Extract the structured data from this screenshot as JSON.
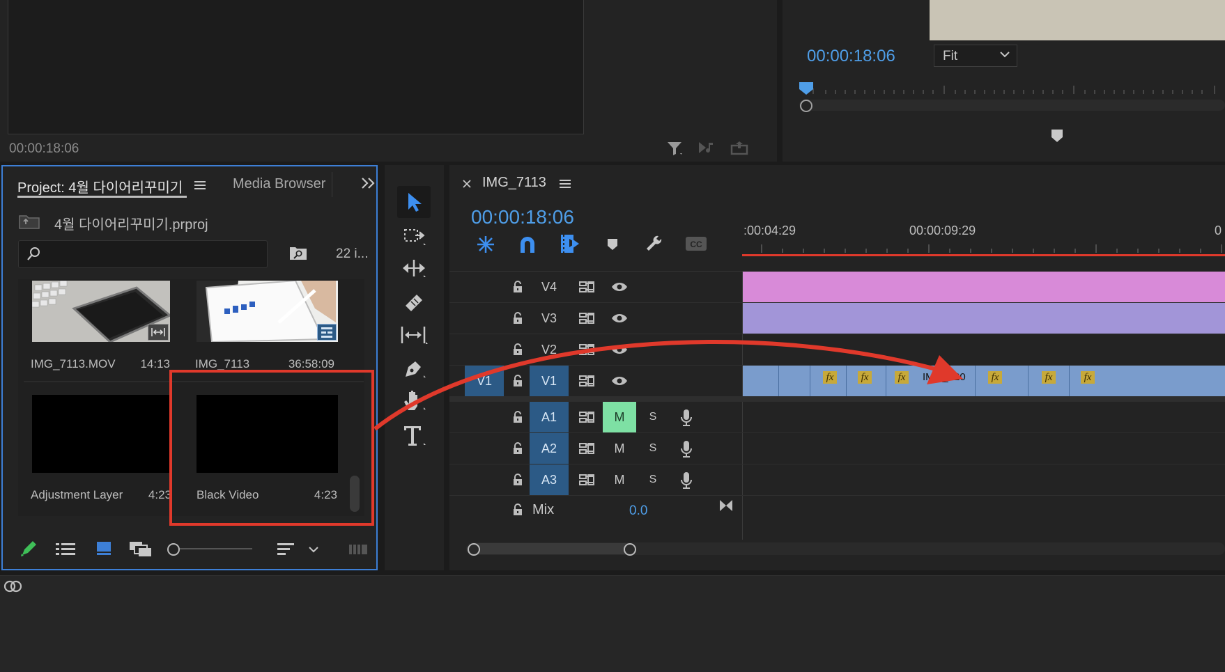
{
  "source_monitor": {
    "timecode": "00:00:18:06"
  },
  "program_monitor": {
    "timecode": "00:00:18:06",
    "zoom": "Fit"
  },
  "project_panel": {
    "tab_project": "Project: 4월 다이어리꾸미기",
    "tab_media_browser": "Media Browser",
    "project_file": "4월 다이어리꾸미기.prproj",
    "search_placeholder": "",
    "item_count": "22 i...",
    "items": [
      {
        "name": "IMG_7113.MOV",
        "duration": "14:13"
      },
      {
        "name": "IMG_7113",
        "duration": "36:58:09"
      },
      {
        "name": "Adjustment Layer",
        "duration": "4:23"
      },
      {
        "name": "Black Video",
        "duration": "4:23"
      }
    ]
  },
  "timeline": {
    "sequence_name": "IMG_7113",
    "timecode": "00:00:18:06",
    "ruler_labels": [
      ":00:04:29",
      "00:00:09:29",
      "0"
    ],
    "tracks": {
      "v4": "V4",
      "v3": "V3",
      "v2": "V2",
      "v1_src": "V1",
      "v1": "V1",
      "a1": "A1",
      "a2": "A2",
      "a3": "A3"
    },
    "mute": "M",
    "solo": "S",
    "mix_label": "Mix",
    "mix_value": "0.0",
    "fx": "fx",
    "clip_label": "IMG_820"
  },
  "colors": {
    "accent_blue": "#4f9ee8",
    "highlight_red": "#e0392b",
    "v4_clip": "#d88ad8",
    "v3_clip": "#a295d8",
    "v1_clip": "#7a9ccc",
    "mute_active": "#7ee0a4"
  }
}
